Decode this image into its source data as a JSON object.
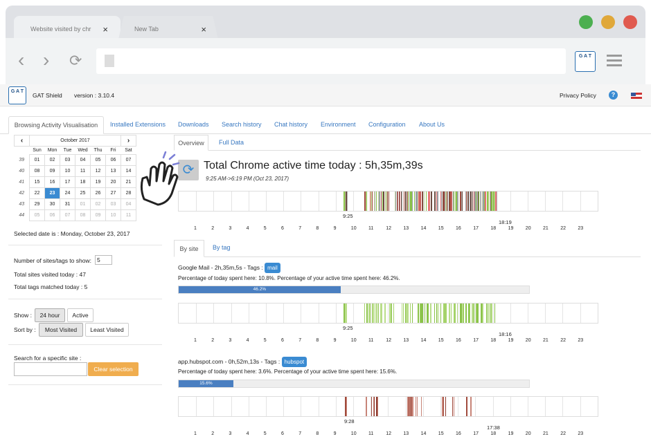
{
  "browser": {
    "tabs": [
      {
        "label": "Website visited by chr"
      },
      {
        "label": "New Tab"
      }
    ],
    "close_glyph": "×",
    "nav": {
      "back": "‹",
      "forward": "›",
      "reload": "⟳"
    }
  },
  "app": {
    "name": "GAT Shield",
    "version": "version : 3.10.4",
    "privacy": "Privacy Policy",
    "help": "?",
    "logo_letters": "G A T"
  },
  "tabs": [
    "Browsing Activity Visualisation",
    "Installed Extensions",
    "Downloads",
    "Search history",
    "Chat history",
    "Environment",
    "Configuration",
    "About Us"
  ],
  "calendar": {
    "month": "October 2017",
    "prev": "‹",
    "next": "›",
    "dow": [
      "Sun",
      "Mon",
      "Tue",
      "Wed",
      "Thu",
      "Fri",
      "Sat"
    ],
    "weeks": [
      [
        "39",
        "01",
        "02",
        "03",
        "04",
        "05",
        "06",
        "07"
      ],
      [
        "40",
        "08",
        "09",
        "10",
        "11",
        "12",
        "13",
        "14"
      ],
      [
        "41",
        "15",
        "16",
        "17",
        "18",
        "19",
        "20",
        "21"
      ],
      [
        "42",
        "22",
        "23",
        "24",
        "25",
        "26",
        "27",
        "28"
      ],
      [
        "43",
        "29",
        "30",
        "31",
        "01",
        "02",
        "03",
        "04"
      ],
      [
        "44",
        "05",
        "06",
        "07",
        "08",
        "09",
        "10",
        "11"
      ]
    ],
    "selected_text": "Selected date is : Monday, October 23, 2017"
  },
  "filters": {
    "num_label": "Number of sites/tags to show:",
    "num_value": "5",
    "total_sites": "Total sites visited today : 47",
    "total_tags": "Total tags matched today : 5",
    "show_label": "Show :",
    "show_opts": [
      "24 hour",
      "Active"
    ],
    "sort_label": "Sort by :",
    "sort_opts": [
      "Most Visited",
      "Least Visited"
    ],
    "search_label": "Search for a specific site :",
    "clear": "Clear selection"
  },
  "view_tabs": [
    "Overview",
    "Full Data"
  ],
  "total": {
    "title": "Total Chrome active time today : 5h,35m,39s",
    "range": "9:25 AM->6:19 PM (Oct 23, 2017)",
    "start": "9:25",
    "end": "18:19"
  },
  "site_tabs": [
    "By site",
    "By tag"
  ],
  "hours": [
    "1",
    "2",
    "3",
    "4",
    "5",
    "6",
    "7",
    "8",
    "9",
    "10",
    "11",
    "12",
    "13",
    "14",
    "15",
    "16",
    "17",
    "18",
    "19",
    "20",
    "21",
    "22",
    "23"
  ],
  "sites": [
    {
      "name": "Google Mail - 2h,35m,5s - Tags :",
      "tag": "mail",
      "pct_text": "Percentage of today spent here:  10.8%.  Percentage of your active time spent here:  46.2%.",
      "bar": 0.462,
      "bar_label": "46.2%",
      "start": "9:25",
      "end": "18:16"
    },
    {
      "name": "app.hubspot.com - 0h,52m,13s - Tags :",
      "tag": "hubspot",
      "pct_text": "Percentage of today spent here:  3.6%.  Percentage of your active time spent here:  15.6%.",
      "bar": 0.156,
      "bar_label": "15.6%",
      "start": "9:28",
      "end": "17:38"
    }
  ],
  "colors": {
    "accent": "#3a8bd2",
    "clear": "#f0ad4e",
    "gmail": "#8bc34a",
    "hubspot": "#a04a3c"
  }
}
